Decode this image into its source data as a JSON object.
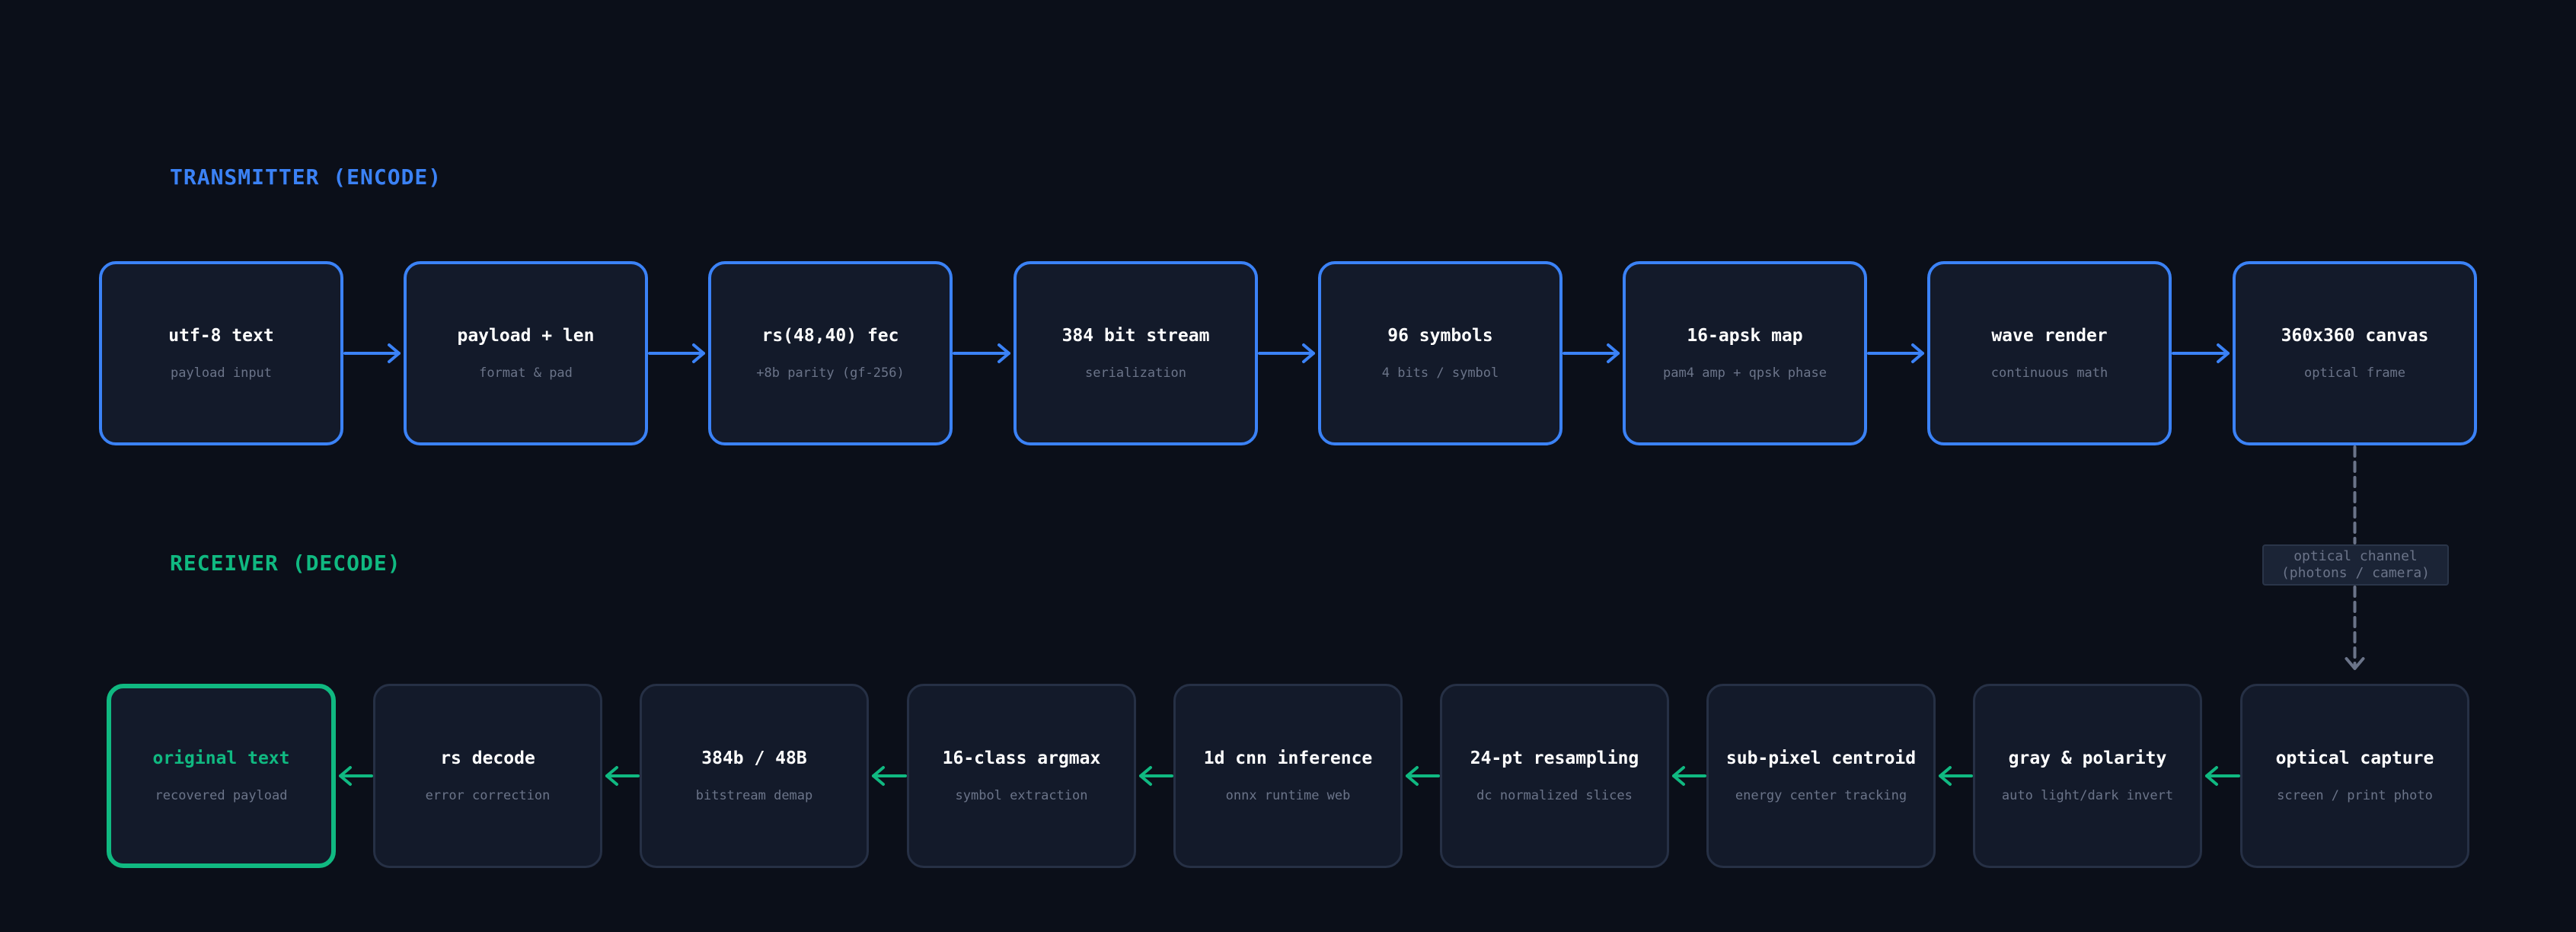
{
  "colors": {
    "background": "#0b0f19",
    "node_fill": "#131a2a",
    "transmitter_accent": "#3b82f6",
    "receiver_accent": "#10b981",
    "receiver_border": "#263045",
    "channel": "#6b7489",
    "title_text": "#ffffff",
    "sub_text": "#6b7489"
  },
  "transmitter": {
    "label": "TRANSMITTER (ENCODE)",
    "nodes": [
      {
        "title": "utf-8 text",
        "subtitle": "payload input"
      },
      {
        "title": "payload + len",
        "subtitle": "format & pad"
      },
      {
        "title": "rs(48,40) fec",
        "subtitle": "+8b parity (gf-256)"
      },
      {
        "title": "384 bit stream",
        "subtitle": "serialization"
      },
      {
        "title": "96 symbols",
        "subtitle": "4 bits / symbol"
      },
      {
        "title": "16-apsk map",
        "subtitle": "pam4 amp + qpsk phase"
      },
      {
        "title": "wave render",
        "subtitle": "continuous math"
      },
      {
        "title": "360x360 canvas",
        "subtitle": "optical frame"
      }
    ]
  },
  "receiver": {
    "label": "RECEIVER (DECODE)",
    "nodes": [
      {
        "title": "original text",
        "subtitle": "recovered payload"
      },
      {
        "title": "rs decode",
        "subtitle": "error correction"
      },
      {
        "title": "384b / 48B",
        "subtitle": "bitstream demap"
      },
      {
        "title": "16-class argmax",
        "subtitle": "symbol extraction"
      },
      {
        "title": "1d cnn inference",
        "subtitle": "onnx runtime web"
      },
      {
        "title": "24-pt resampling",
        "subtitle": "dc normalized slices"
      },
      {
        "title": "sub-pixel centroid",
        "subtitle": "energy center tracking"
      },
      {
        "title": "gray & polarity",
        "subtitle": "auto light/dark invert"
      },
      {
        "title": "optical capture",
        "subtitle": "screen / print photo"
      }
    ]
  },
  "channel": {
    "line1": "optical channel",
    "line2": "(photons / camera)"
  }
}
